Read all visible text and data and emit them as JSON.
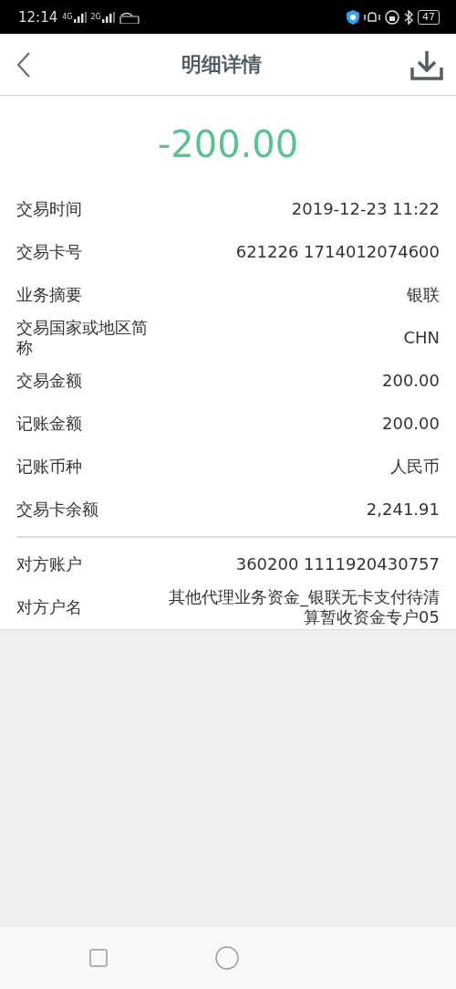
{
  "status_bar": {
    "time": "12:14",
    "network_1": "4G",
    "network_2": "2G",
    "battery": "47"
  },
  "header": {
    "title": "明细详情"
  },
  "amount": "-200.00",
  "details": [
    {
      "label": "交易时间",
      "value": "2019-12-23 11:22"
    },
    {
      "label": "交易卡号",
      "value": "621226 1714012074600"
    },
    {
      "label": "业务摘要",
      "value": "银联"
    },
    {
      "label": "交易国家或地区简称",
      "value": "CHN"
    },
    {
      "label": "交易金额",
      "value": "200.00"
    },
    {
      "label": "记账金额",
      "value": "200.00"
    },
    {
      "label": "记账币种",
      "value": "人民币"
    },
    {
      "label": "交易卡余额",
      "value": "2,241.91"
    }
  ],
  "counterparty": [
    {
      "label": "对方账户",
      "value": "360200 1111920430757"
    },
    {
      "label": "对方户名",
      "value": "其他代理业务资金_银联无卡支付待清算暂收资金专户05"
    }
  ]
}
